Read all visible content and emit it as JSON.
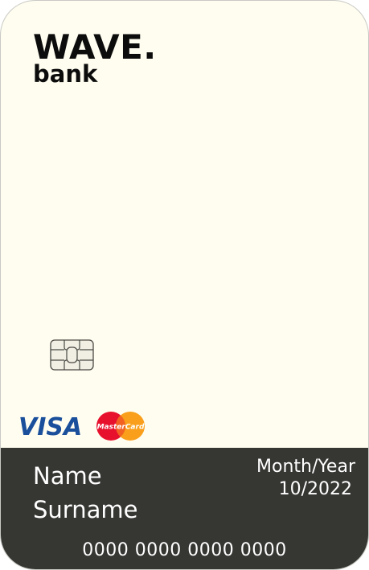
{
  "card": {
    "bank_name": "WAVE.",
    "bank_subname": "bank",
    "holder_first": "Name",
    "holder_last": "Surname",
    "expiry_label": "Month/Year",
    "expiry_value": "10/2022",
    "number": "0000 0000 0000 0000",
    "networks": {
      "visa": "VISA",
      "mastercard": "MasterCard"
    },
    "icons": [
      "chip-icon",
      "visa-logo",
      "mastercard-logo"
    ]
  },
  "colors": {
    "card_background": "#fffdf0",
    "bottom_band": "#363633",
    "text_dark": "#0c0c0c",
    "text_light": "#ffffff",
    "visa_blue": "#1a4f9c",
    "mastercard_red": "#e8112d",
    "mastercard_orange": "#f99f1b"
  }
}
